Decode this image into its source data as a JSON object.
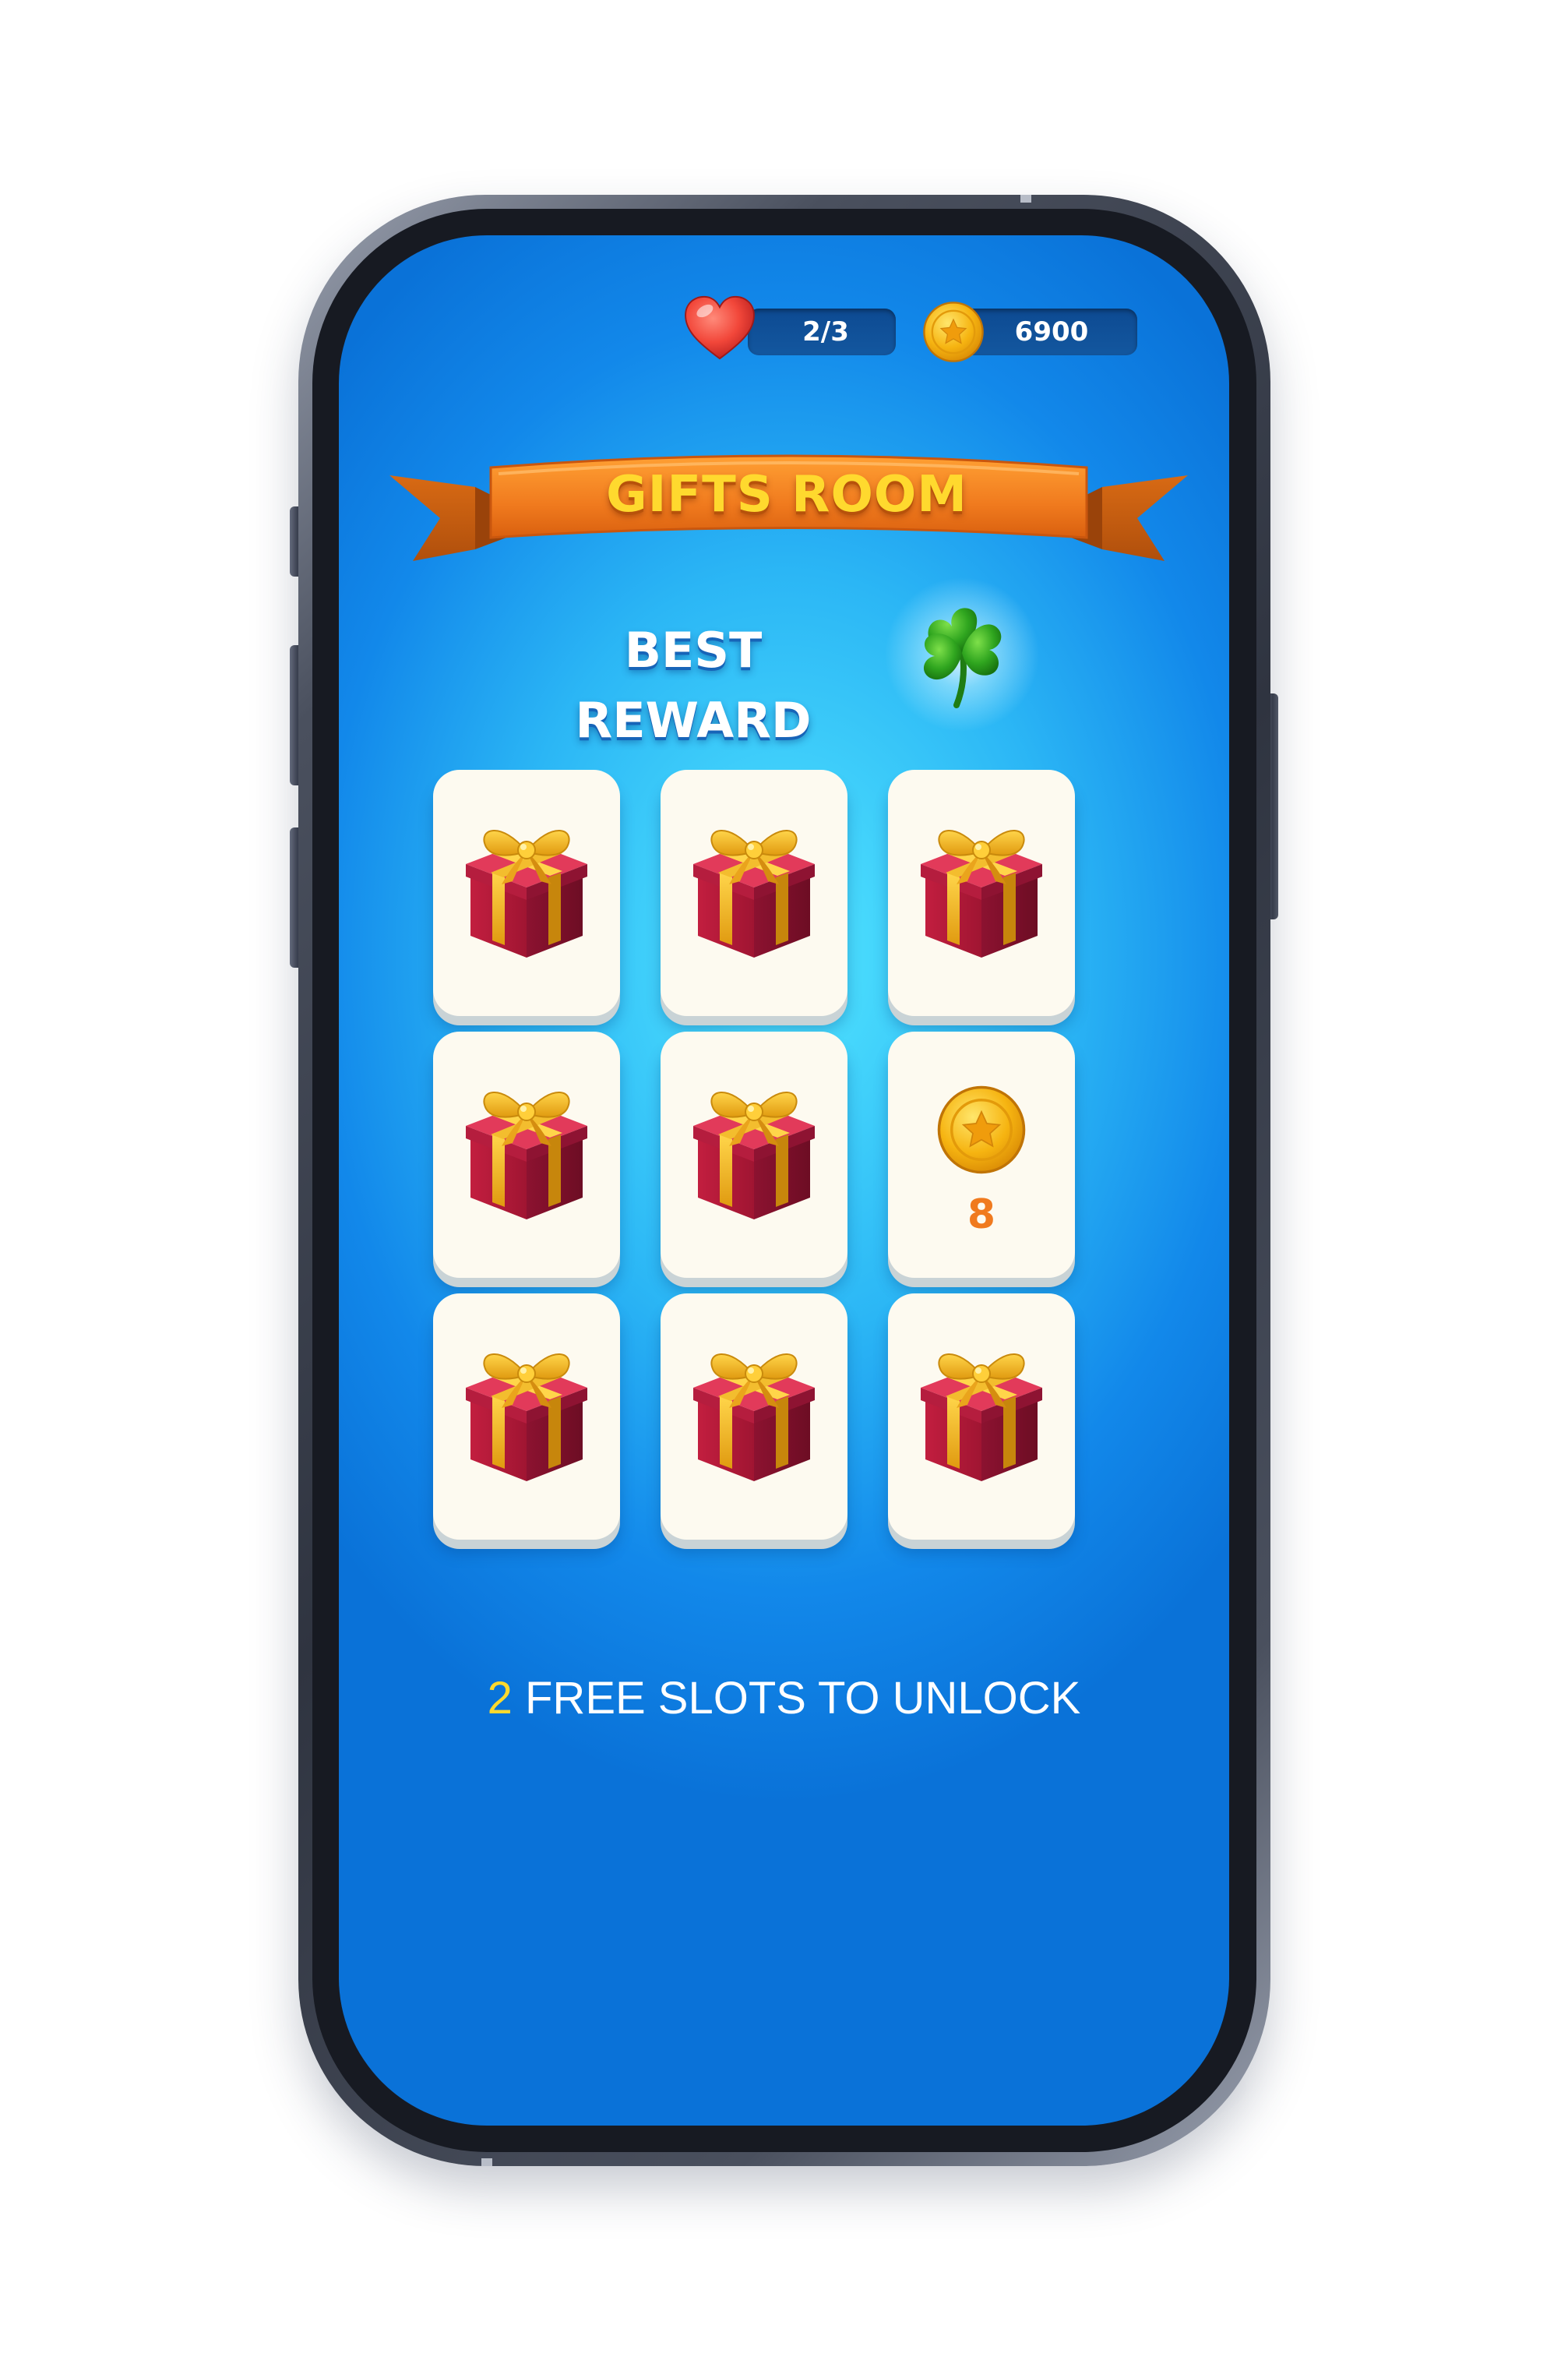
{
  "hud": {
    "lives": "2/3",
    "coins": "6900"
  },
  "banner": {
    "title": "GIFTS ROOM"
  },
  "reward": {
    "label": "BEST REWARD",
    "icon": "four-leaf-clover-icon"
  },
  "grid": {
    "tiles": [
      {
        "type": "gift",
        "icon": "gift-box-icon"
      },
      {
        "type": "gift",
        "icon": "gift-box-icon"
      },
      {
        "type": "gift",
        "icon": "gift-box-icon"
      },
      {
        "type": "gift",
        "icon": "gift-box-icon"
      },
      {
        "type": "gift",
        "icon": "gift-box-icon"
      },
      {
        "type": "coin",
        "icon": "coin-icon",
        "amount": "8"
      },
      {
        "type": "gift",
        "icon": "gift-box-icon"
      },
      {
        "type": "gift",
        "icon": "gift-box-icon"
      },
      {
        "type": "gift",
        "icon": "gift-box-icon"
      }
    ]
  },
  "footer": {
    "free_count": "2",
    "free_text": " FREE SLOTS TO UNLOCK"
  },
  "colors": {
    "accent_yellow": "#ffd92e",
    "banner_orange": "#f07a1e",
    "screen_blue": "#1288ea"
  }
}
